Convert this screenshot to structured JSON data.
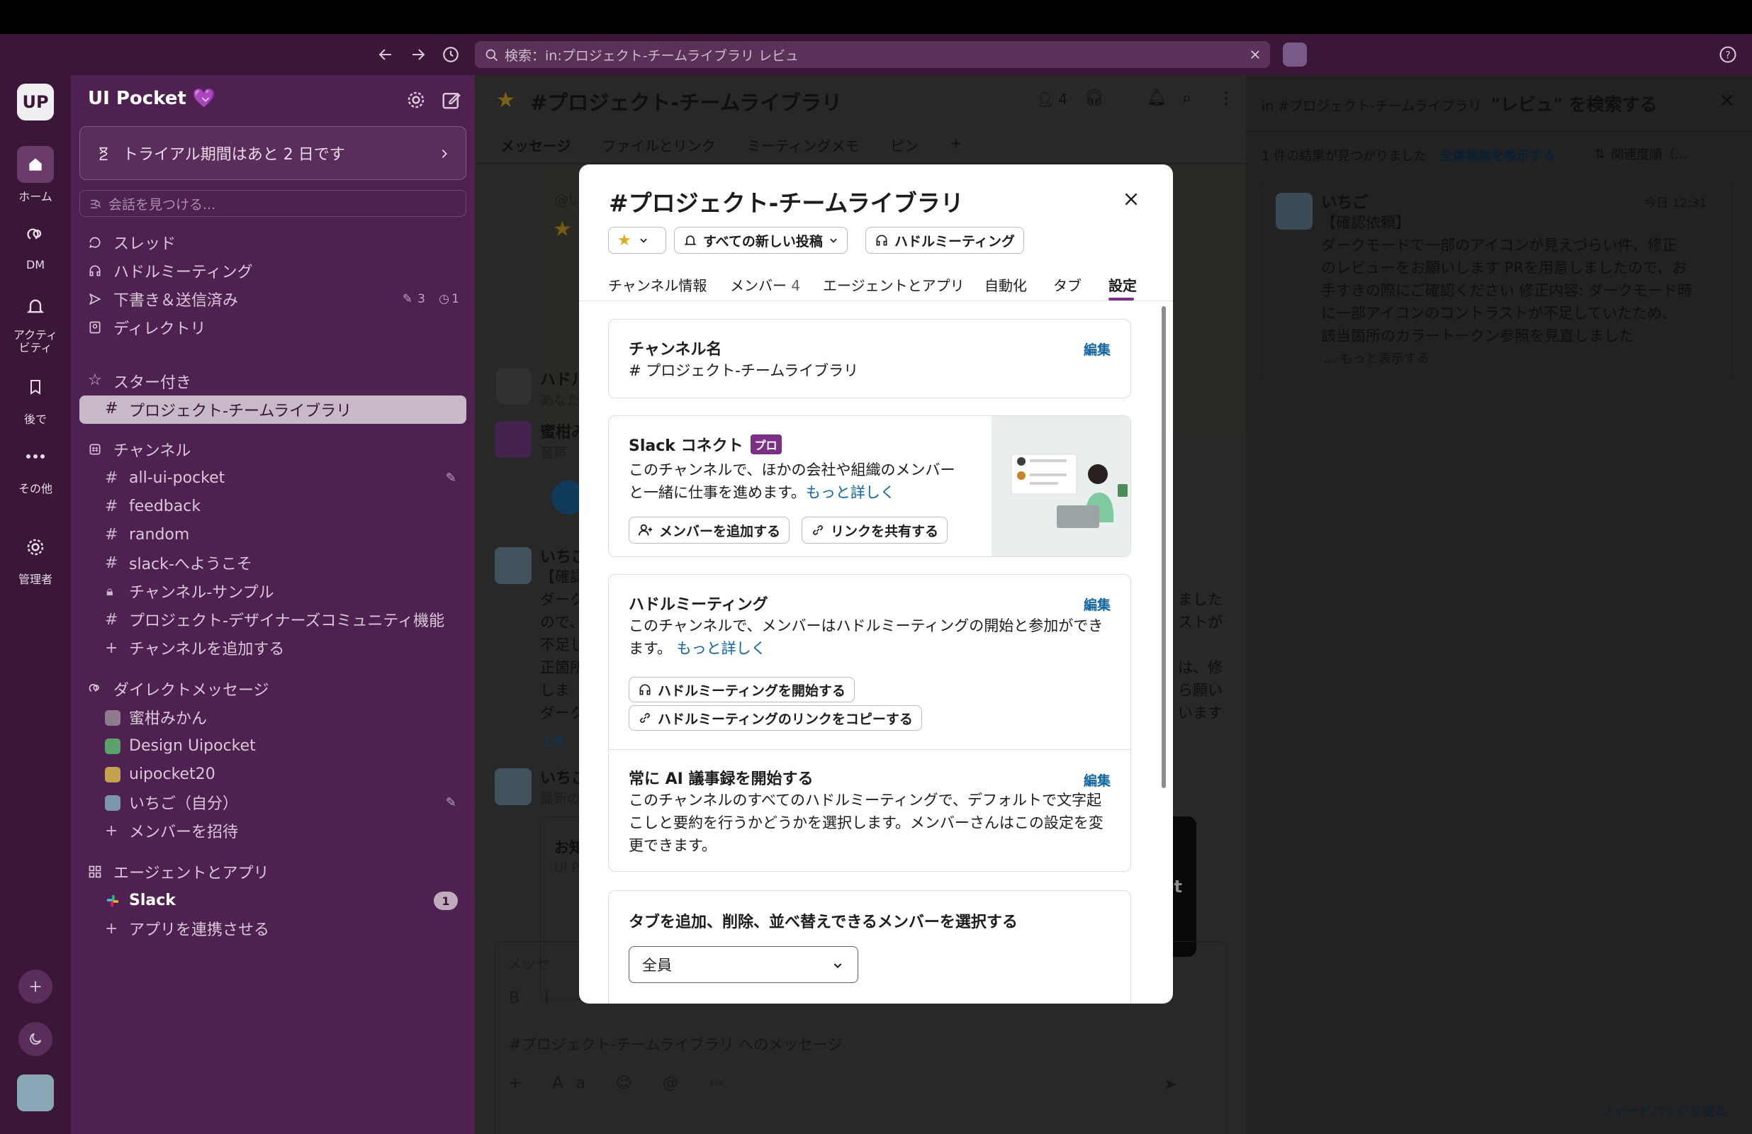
{
  "search": {
    "query": "検索：in:プロジェクト-チームライブラリ レビュ"
  },
  "rail": {
    "workspace_initials": "UP",
    "home": "ホーム",
    "dm": "DM",
    "activity_line1": "アクティ",
    "activity_line2": "ビティ",
    "later": "後で",
    "more": "その他",
    "admin": "管理者"
  },
  "sidebar": {
    "workspace_name": "UI Pocket 💜",
    "trial_banner": "トライアル期間はあと 2 日です",
    "find_placeholder": "会話を見つける...",
    "threads": "スレッド",
    "huddles": "ハドルミーティング",
    "drafts": "下書き＆送信済み",
    "drafts_count": "3",
    "drafts_scheduled": "1",
    "directory": "ディレクトリ",
    "starred_header": "スター付き",
    "starred_channel": "プロジェクト-チームライブラリ",
    "channels_header": "チャンネル",
    "channels": [
      "all-ui-pocket",
      "feedback",
      "random",
      "slack-へようこそ",
      "チャンネル-サンプル",
      "プロジェクト-デザイナーズコミュニティ機能"
    ],
    "add_channel": "チャンネルを追加する",
    "dm_header": "ダイレクトメッセージ",
    "dms": [
      "蜜柑みかん",
      "Design Uipocket",
      "uipocket20",
      "いちご（自分）"
    ],
    "invite": "メンバーを招待",
    "apps_header": "エージェントとアプリ",
    "slack_app": "Slack",
    "slack_badge": "1",
    "connect_apps": "アプリを連携させる"
  },
  "channel_header": {
    "title": "#プロジェクト-チームライブラリ",
    "member_count": "4",
    "tabs": [
      "メッセージ",
      "ファイルとリンク",
      "ミーティングメモ",
      "ピン"
    ]
  },
  "background_messages": {
    "snip1": "@い",
    "huddle_title": "ハドル",
    "huddle_sub": "あなた",
    "mikan_name": "蜜柑み",
    "mikan_sub": "音声",
    "ichigo_name": "いちご",
    "ichigo_tag": "【確認",
    "line1": "ダーク",
    "line2": "ので、",
    "line3": "不足し",
    "line4": "正箇所",
    "line5": "しま",
    "line6": "ダーク",
    "right1": "ました",
    "right2": "ストが",
    "right3": "は、修",
    "right4": "ら願い",
    "right5": "います",
    "thread_count": "1件",
    "ichigo2_name": "いちご",
    "ichigo2_sub": "最新の",
    "card_title": "お知",
    "card_sub": "UI P",
    "card_brand": "ocket",
    "composer_top": "メッセ",
    "composer_placeholder": "#プロジェクト-チームライブラリ へのメッセージ"
  },
  "right_pane": {
    "title_prefix": "in #プロジェクト-チームライブラリ",
    "title_query": "\"レビュ\" を検索する",
    "result_count": "1 件の結果が見つかりました",
    "full_search": "全体検索を表示する",
    "sort": "関連度順（...",
    "result": {
      "author": "いちご",
      "time": "今日 12:31",
      "tag": "【確認依頼】",
      "line1": "ダークモードで一部のアイコンが見えづらい件、修正",
      "line2": "のレビューをお願いします PRを用意しましたので、お",
      "line3": "手すきの際にご確認ください 修正内容: ダークモード時",
      "line4": "に一部アイコンのコントラストが不足していたため、",
      "line5": "該当箇所のカラートークン参照を見直しました",
      "more": "... もっと表示する"
    },
    "feedback": "フィードバックを送る"
  },
  "modal": {
    "title": "#プロジェクト-チームライブラリ",
    "notify_button": "すべての新しい投稿",
    "huddle_button": "ハドルミーティング",
    "tabs": [
      "チャンネル情報",
      "メンバー",
      "エージェントとアプリ",
      "自動化",
      "タブ",
      "設定"
    ],
    "member_tab_count": "4",
    "active_tab": "設定",
    "channel_name_label": "チャンネル名",
    "channel_name_value": "# プロジェクト-チームライブラリ",
    "edit": "編集",
    "connect_title": "Slack コネクト",
    "pro_badge": "プロ",
    "connect_desc1": "このチャンネルで、ほかの会社や組織のメンバー",
    "connect_desc2": "と一緒に仕事を進めます。",
    "learn_more": "もっと詳しく",
    "add_members": "メンバーを追加する",
    "share_link": "リンクを共有する",
    "huddle_title": "ハドルミーティング",
    "huddle_desc1": "このチャンネルで、メンバーはハドルミーティングの開始と参加ができ",
    "huddle_desc2": "ます。",
    "start_huddle": "ハドルミーティングを開始する",
    "copy_huddle_link": "ハドルミーティングのリンクをコピーする",
    "ai_title": "常に AI 議事録を開始する",
    "ai_desc1": "このチャンネルのすべてのハドルミーティングで、デフォルトで文字起",
    "ai_desc2": "こしと要約を行うかどうかを選択します。メンバーさんはこの設定を変",
    "ai_desc3": "更できます。",
    "tabs_perm_title": "タブを追加、削除、並べ替えできるメンバーを選択する",
    "tabs_perm_value": "全員"
  },
  "colors": {
    "aubergine": "#4e2150",
    "accent_link": "#1264a3",
    "pro_badge": "#7c3085",
    "active_tab": "#7c3085"
  }
}
